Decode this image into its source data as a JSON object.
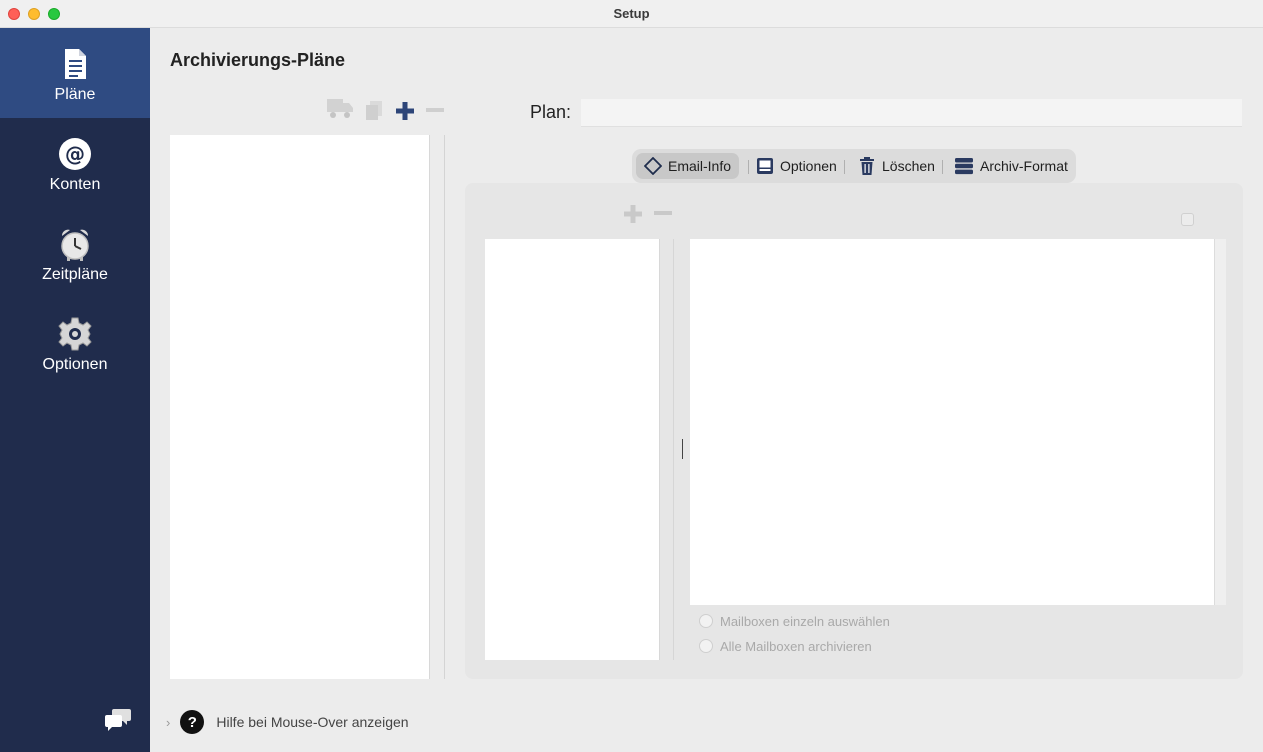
{
  "window": {
    "title": "Setup"
  },
  "sidebar": {
    "items": [
      {
        "label": "Pläne",
        "icon": "document-icon"
      },
      {
        "label": "Konten",
        "icon": "at-icon"
      },
      {
        "label": "Zeitpläne",
        "icon": "alarm-clock-icon"
      },
      {
        "label": "Optionen",
        "icon": "gear-icon"
      }
    ],
    "active": "Pläne",
    "footer_icon": "chat-bubbles-icon"
  },
  "main": {
    "title": "Archivierungs-Pläne",
    "toolbar_icons": [
      "truck-icon",
      "duplicate-icon",
      "plus-icon",
      "minus-icon"
    ],
    "plan": {
      "label": "Plan:",
      "value": ""
    },
    "tabs": [
      {
        "label": "Email-Info",
        "icon": "tag-icon",
        "selected": true
      },
      {
        "label": "Optionen",
        "icon": "window-icon",
        "selected": false
      },
      {
        "label": "Löschen",
        "icon": "trash-icon",
        "selected": false
      },
      {
        "label": "Archiv-Format",
        "icon": "stack-icon",
        "selected": false
      }
    ],
    "radios": [
      {
        "label": "Mailboxen einzeln auswählen"
      },
      {
        "label": "Alle Mailboxen archivieren"
      }
    ]
  },
  "footer": {
    "help_text": "Hilfe bei Mouse-Over anzeigen"
  },
  "colors": {
    "sidebar": "#202c4c",
    "sidebar_active": "#2f4b82",
    "accent_icon": "#2d4578"
  }
}
